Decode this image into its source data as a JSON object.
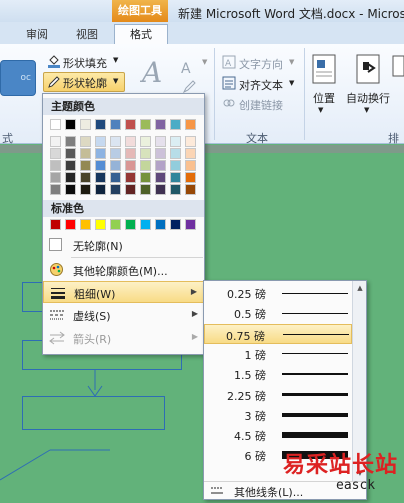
{
  "window": {
    "context_tab": "绘图工具",
    "doc_title": "新建 Microsoft Word 文档.docx - Microso"
  },
  "tabs": [
    {
      "label": "审阅"
    },
    {
      "label": "视图"
    },
    {
      "label": "格式",
      "active": true
    }
  ],
  "ribbon": {
    "shape_preview": "oc",
    "shape_fill": "形状填充",
    "shape_outline": "形状轮廓",
    "text_direction": "文字方向",
    "align_text": "对齐文本",
    "create_link": "创建链接",
    "position": "位置",
    "wrap_text": "自动换行",
    "group_text": "文本",
    "group_arrange": "排",
    "group_style": "式"
  },
  "outline_menu": {
    "theme_colors_header": "主题颜色",
    "standard_colors_header": "标准色",
    "no_outline": "无轮廓(N)",
    "more_colors": "其他轮廓颜色(M)...",
    "weight": "粗细(W)",
    "dashes": "虚线(S)",
    "arrows": "箭头(R)",
    "theme_colors": [
      [
        "#ffffff",
        "#000000",
        "#eeece1",
        "#1f497d",
        "#4f81bd",
        "#c0504d",
        "#9bbb59",
        "#8064a2",
        "#4bacc6",
        "#f79646"
      ],
      [
        "#f2f2f2",
        "#7f7f7f",
        "#ddd9c3",
        "#c6d9f0",
        "#dbe5f1",
        "#f2dcdb",
        "#ebf1dd",
        "#e5e0ec",
        "#dbeef3",
        "#fdeada"
      ],
      [
        "#d8d8d8",
        "#595959",
        "#c4bd97",
        "#8db3e2",
        "#b8cce4",
        "#e5b9b7",
        "#d7e3bc",
        "#ccc1d9",
        "#b7dde8",
        "#fbd5b5"
      ],
      [
        "#bfbfbf",
        "#3f3f3f",
        "#938953",
        "#548dd4",
        "#95b3d7",
        "#d99694",
        "#c3d69b",
        "#b2a2c7",
        "#92cddc",
        "#fac08f"
      ],
      [
        "#a5a5a5",
        "#262626",
        "#494429",
        "#17365d",
        "#366092",
        "#953734",
        "#76923c",
        "#5f497a",
        "#31859b",
        "#e36c09"
      ],
      [
        "#7f7f7f",
        "#0c0c0c",
        "#1d1b10",
        "#0f243e",
        "#244061",
        "#632423",
        "#4f6128",
        "#3f3151",
        "#205867",
        "#974806"
      ]
    ],
    "standard_colors": [
      "#c00000",
      "#ff0000",
      "#ffc000",
      "#ffff00",
      "#92d050",
      "#00b050",
      "#00b0f0",
      "#0070c0",
      "#002060",
      "#7030a0"
    ]
  },
  "weight_submenu": {
    "options": [
      {
        "label": "0.25 磅",
        "pt": 0.25
      },
      {
        "label": "0.5 磅",
        "pt": 0.5
      },
      {
        "label": "0.75 磅",
        "pt": 0.75,
        "selected": true
      },
      {
        "label": "1 磅",
        "pt": 1
      },
      {
        "label": "1.5 磅",
        "pt": 1.5
      },
      {
        "label": "2.25 磅",
        "pt": 2.25
      },
      {
        "label": "3 磅",
        "pt": 3
      },
      {
        "label": "4.5 磅",
        "pt": 4.5
      },
      {
        "label": "6 磅",
        "pt": 6
      }
    ],
    "more_lines": "其他线条(L)..."
  },
  "watermark": {
    "text": "易采站长站",
    "url": "easck"
  }
}
